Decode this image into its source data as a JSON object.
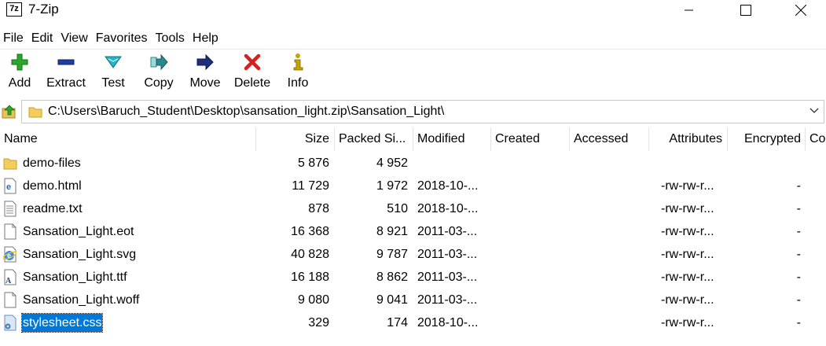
{
  "window": {
    "title": "7-Zip",
    "app_icon": "7z"
  },
  "menu": [
    "File",
    "Edit",
    "View",
    "Favorites",
    "Tools",
    "Help"
  ],
  "toolbar": {
    "add": "Add",
    "extract": "Extract",
    "test": "Test",
    "copy": "Copy",
    "move": "Move",
    "delete": "Delete",
    "info": "Info"
  },
  "address": {
    "path": "C:\\Users\\Baruch_Student\\Desktop\\sansation_light.zip\\Sansation_Light\\"
  },
  "columns": {
    "name": "Name",
    "size": "Size",
    "packed": "Packed Si...",
    "modified": "Modified",
    "created": "Created",
    "accessed": "Accessed",
    "attributes": "Attributes",
    "encrypted": "Encrypted",
    "comment": "Co"
  },
  "files": [
    {
      "name": "demo-files",
      "icon": "folder-icon",
      "size": "5 876",
      "packed": "4 952",
      "modified": "",
      "attributes": "",
      "encrypted": ""
    },
    {
      "name": "demo.html",
      "icon": "edge-html-icon",
      "size": "11 729",
      "packed": "1 972",
      "modified": "2018-10-...",
      "attributes": "-rw-rw-r...",
      "encrypted": "-"
    },
    {
      "name": "readme.txt",
      "icon": "text-file-icon",
      "size": "878",
      "packed": "510",
      "modified": "2018-10-...",
      "attributes": "-rw-rw-r...",
      "encrypted": "-"
    },
    {
      "name": "Sansation_Light.eot",
      "icon": "blank-file-icon",
      "size": "16 368",
      "packed": "8 921",
      "modified": "2011-03-...",
      "attributes": "-rw-rw-r...",
      "encrypted": "-"
    },
    {
      "name": "Sansation_Light.svg",
      "icon": "ie-svg-icon",
      "size": "40 828",
      "packed": "9 787",
      "modified": "2011-03-...",
      "attributes": "-rw-rw-r...",
      "encrypted": "-"
    },
    {
      "name": "Sansation_Light.ttf",
      "icon": "font-file-icon",
      "size": "16 188",
      "packed": "8 862",
      "modified": "2011-03-...",
      "attributes": "-rw-rw-r...",
      "encrypted": "-"
    },
    {
      "name": "Sansation_Light.woff",
      "icon": "blank-file-icon",
      "size": "9 080",
      "packed": "9 041",
      "modified": "2011-03-...",
      "attributes": "-rw-rw-r...",
      "encrypted": "-"
    },
    {
      "name": "stylesheet.css",
      "icon": "css-file-icon",
      "size": "329",
      "packed": "174",
      "modified": "2018-10-...",
      "attributes": "-rw-rw-r...",
      "encrypted": "-",
      "selected": true
    }
  ],
  "colors": {
    "selection": "#0078d7",
    "add": "#2aa82a",
    "extract": "#1c3fa0",
    "test": "#25b5c7",
    "copy": "#2a8a8a",
    "move": "#1f2f7a",
    "delete": "#d61f1f",
    "info": "#c9a400"
  }
}
